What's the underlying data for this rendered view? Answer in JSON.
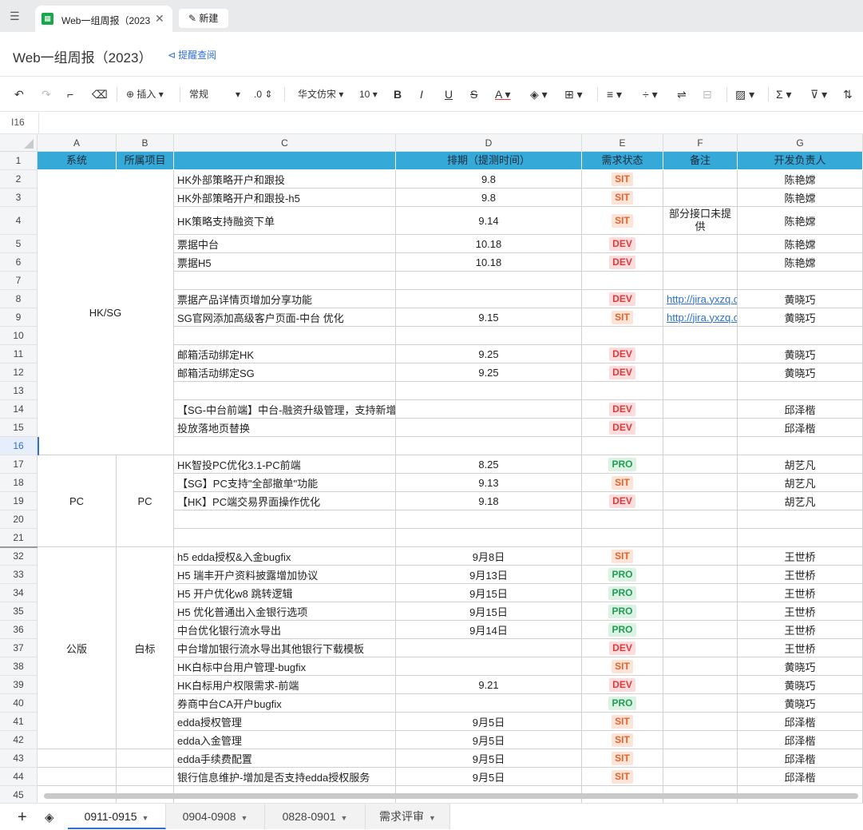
{
  "window": {
    "tab_title": "Web一组周报（2023",
    "new_tab_label": "新建"
  },
  "doc": {
    "title": "Web一组周报（2023）",
    "remind_label": "提醒查阅"
  },
  "toolbar": {
    "insert_label": "插入",
    "format_label": "常规",
    "decimal_label": ".0",
    "font_label": "华文仿宋",
    "size_label": "10",
    "bold": "B",
    "italic": "I",
    "underline": "U",
    "strike": "S",
    "fontcolor": "A"
  },
  "formula_bar": {
    "cell_ref": "I16"
  },
  "columns": [
    "A",
    "B",
    "C",
    "D",
    "E",
    "F",
    "G"
  ],
  "header_row": {
    "A": "系统",
    "B": "所属项目",
    "C": "",
    "D": "排期（提测时间）",
    "E": "需求状态",
    "F": "备注",
    "G": "开发负责人"
  },
  "row_numbers": [
    "1",
    "2",
    "3",
    "4",
    "5",
    "6",
    "7",
    "8",
    "9",
    "10",
    "11",
    "12",
    "13",
    "14",
    "15",
    "16",
    "17",
    "18",
    "19",
    "20",
    "21",
    "32",
    "33",
    "34",
    "35",
    "36",
    "37",
    "38",
    "39",
    "40",
    "41",
    "42",
    "43",
    "44",
    "45"
  ],
  "groups": [
    {
      "label": "HK/SG"
    },
    {
      "a": "PC",
      "b": "PC"
    },
    {
      "a": "公版",
      "b": "白标"
    }
  ],
  "rows": [
    {
      "C": "HK外部策略开户和跟投",
      "D": "9.8",
      "E": "SIT",
      "F": "",
      "G": "陈艳嫦"
    },
    {
      "C": "HK外部策略开户和跟投-h5",
      "D": "9.8",
      "E": "SIT",
      "F": "",
      "G": "陈艳嫦"
    },
    {
      "C": "HK策略支持融资下单",
      "D": "9.14",
      "E": "SIT",
      "F": "部分接口未提供",
      "G": "陈艳嫦"
    },
    {
      "C": "票据中台",
      "D": "10.18",
      "E": "DEV",
      "F": "",
      "G": "陈艳嫦"
    },
    {
      "C": "票据H5",
      "D": "10.18",
      "E": "DEV",
      "F": "",
      "G": "陈艳嫦"
    },
    {
      "C": "",
      "D": "",
      "E": "",
      "F": "",
      "G": ""
    },
    {
      "C": "票据产品详情页增加分享功能",
      "D": "",
      "E": "DEV",
      "F": "http://jira.yxzq.c",
      "G": "黄晓巧"
    },
    {
      "C": "SG官网添加高级客户页面-中台 优化",
      "D": "9.15",
      "E": "SIT",
      "F": "http://jira.yxzq.c",
      "G": "黄晓巧"
    },
    {
      "C": "",
      "D": "",
      "E": "",
      "F": "",
      "G": ""
    },
    {
      "C": "邮箱活动绑定HK",
      "D": "9.25",
      "E": "DEV",
      "F": "",
      "G": "黄晓巧"
    },
    {
      "C": "邮箱活动绑定SG",
      "D": "9.25",
      "E": "DEV",
      "F": "",
      "G": "黄晓巧"
    },
    {
      "C": "",
      "D": "",
      "E": "",
      "F": "",
      "G": ""
    },
    {
      "C": "【SG-中台前端】中台-融资升级管理，支持新增客户现金升融资",
      "D": "",
      "E": "DEV",
      "F": "",
      "G": "邱泽楷"
    },
    {
      "C": "投放落地页替换",
      "D": "",
      "E": "DEV",
      "F": "",
      "G": "邱泽楷"
    },
    {
      "C": "",
      "D": "",
      "E": "",
      "F": "",
      "G": ""
    },
    {
      "C": "HK智投PC优化3.1-PC前端",
      "D": "8.25",
      "E": "PRO",
      "F": "",
      "G": "胡艺凡"
    },
    {
      "C": "【SG】PC支持\"全部撤单\"功能",
      "D": "9.13",
      "E": "SIT",
      "F": "",
      "G": "胡艺凡"
    },
    {
      "C": "【HK】PC端交易界面操作优化",
      "D": "9.18",
      "E": "DEV",
      "F": "",
      "G": "胡艺凡"
    },
    {
      "C": "",
      "D": "",
      "E": "",
      "F": "",
      "G": ""
    },
    {
      "C": "",
      "D": "",
      "E": "",
      "F": "",
      "G": ""
    },
    {
      "C": "h5 edda授权&入金bugfix",
      "D": "9月8日",
      "E": "SIT",
      "F": "",
      "G": "王世桥"
    },
    {
      "C": "H5 瑞丰开户资料披露增加协议",
      "D": "9月13日",
      "E": "PRO",
      "F": "",
      "G": "王世桥"
    },
    {
      "C": "H5 开户优化w8 跳转逻辑",
      "D": "9月15日",
      "E": "PRO",
      "F": "",
      "G": "王世桥"
    },
    {
      "C": "H5 优化普通出入金银行选项",
      "D": "9月15日",
      "E": "PRO",
      "F": "",
      "G": "王世桥"
    },
    {
      "C": "中台优化银行流水导出",
      "D": "9月14日",
      "E": "PRO",
      "F": "",
      "G": "王世桥"
    },
    {
      "C": "中台增加银行流水导出其他银行下载模板",
      "D": "",
      "E": "DEV",
      "F": "",
      "G": "王世桥"
    },
    {
      "C": "HK白标中台用户管理-bugfix",
      "D": "",
      "E": "SIT",
      "F": "",
      "G": "黄晓巧"
    },
    {
      "C": "HK白标用户权限需求-前端",
      "D": "9.21",
      "E": "DEV",
      "F": "",
      "G": "黄晓巧"
    },
    {
      "C": "券商中台CA开户bugfix",
      "D": "",
      "E": "PRO",
      "F": "",
      "G": "黄晓巧"
    },
    {
      "C": "edda授权管理",
      "D": "9月5日",
      "E": "SIT",
      "F": "",
      "G": "邱泽楷"
    },
    {
      "C": "edda入金管理",
      "D": "9月5日",
      "E": "SIT",
      "F": "",
      "G": "邱泽楷"
    },
    {
      "C": "edda手续费配置",
      "D": "9月5日",
      "E": "SIT",
      "F": "",
      "G": "邱泽楷"
    },
    {
      "C": "银行信息维护-增加是否支持edda授权服务",
      "D": "9月5日",
      "E": "SIT",
      "F": "",
      "G": "邱泽楷"
    },
    {
      "C": "",
      "D": "",
      "E": "",
      "F": "",
      "G": ""
    }
  ],
  "sheet_tabs": [
    "0911-0915",
    "0904-0908",
    "0828-0901",
    "需求评审"
  ],
  "colors": {
    "header_bg": "#35a9d8",
    "sit": "#e8632c",
    "dev": "#e0393b",
    "pro": "#1f9d55",
    "accent": "#2f6fd6"
  }
}
